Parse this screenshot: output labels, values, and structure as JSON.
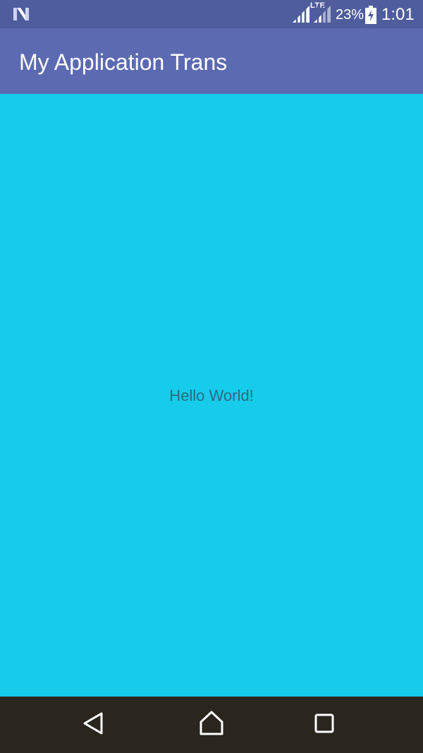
{
  "status_bar": {
    "network_type": "LTE",
    "battery_percent": "23%",
    "time": "1:01",
    "icons": [
      "android-n-icon",
      "signal-icon",
      "signal-icon",
      "battery-charging-icon"
    ]
  },
  "app_bar": {
    "title": "My Application Trans"
  },
  "content": {
    "message": "Hello World!"
  },
  "nav_bar": {
    "icons": [
      "back-icon",
      "home-icon",
      "recents-icon"
    ]
  },
  "colors": {
    "status_bar": "#4f5d9d",
    "app_bar": "#5c6ab2",
    "content_background": "#17cbeb",
    "text": "#2b6a80",
    "nav_bar": "#2a261d"
  }
}
